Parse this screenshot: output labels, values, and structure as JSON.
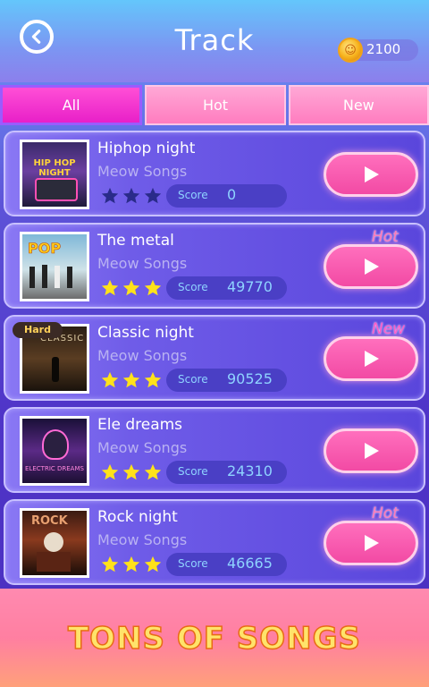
{
  "header": {
    "title": "Track",
    "coins": "2100",
    "back_icon": "back-arrow-icon",
    "coin_icon": "coin-icon"
  },
  "tabs": [
    {
      "label": "All",
      "active": true
    },
    {
      "label": "Hot",
      "active": false
    },
    {
      "label": "New",
      "active": false
    }
  ],
  "songs": [
    {
      "title": "Hiphop night",
      "artist": "Meow Songs",
      "score_label": "Score",
      "score": "0",
      "stars": 0,
      "tag": "",
      "badge": "",
      "cover_text": "HIP HOP NIGHT"
    },
    {
      "title": "The metal",
      "artist": "Meow Songs",
      "score_label": "Score",
      "score": "49770",
      "stars": 3,
      "tag": "Hot",
      "badge": "",
      "cover_text": "POP"
    },
    {
      "title": "Classic night",
      "artist": "Meow Songs",
      "score_label": "Score",
      "score": "90525",
      "stars": 3,
      "tag": "New",
      "badge": "Hard",
      "cover_text": "CLASSIC"
    },
    {
      "title": "Ele dreams",
      "artist": "Meow Songs",
      "score_label": "Score",
      "score": "24310",
      "stars": 3,
      "tag": "",
      "badge": "",
      "cover_text": "ELECTRIC DREAMS"
    },
    {
      "title": "Rock night",
      "artist": "Meow Songs",
      "score_label": "Score",
      "score": "46665",
      "stars": 3,
      "tag": "Hot",
      "badge": "",
      "cover_text": "ROCK"
    }
  ],
  "banner": {
    "text": "TONS OF SONGS"
  },
  "colors": {
    "star_filled": "#ffe21a",
    "star_empty": "#2a2b8a",
    "play_pink": "#f24aa4",
    "accent_cyan": "#8fd3ff"
  }
}
